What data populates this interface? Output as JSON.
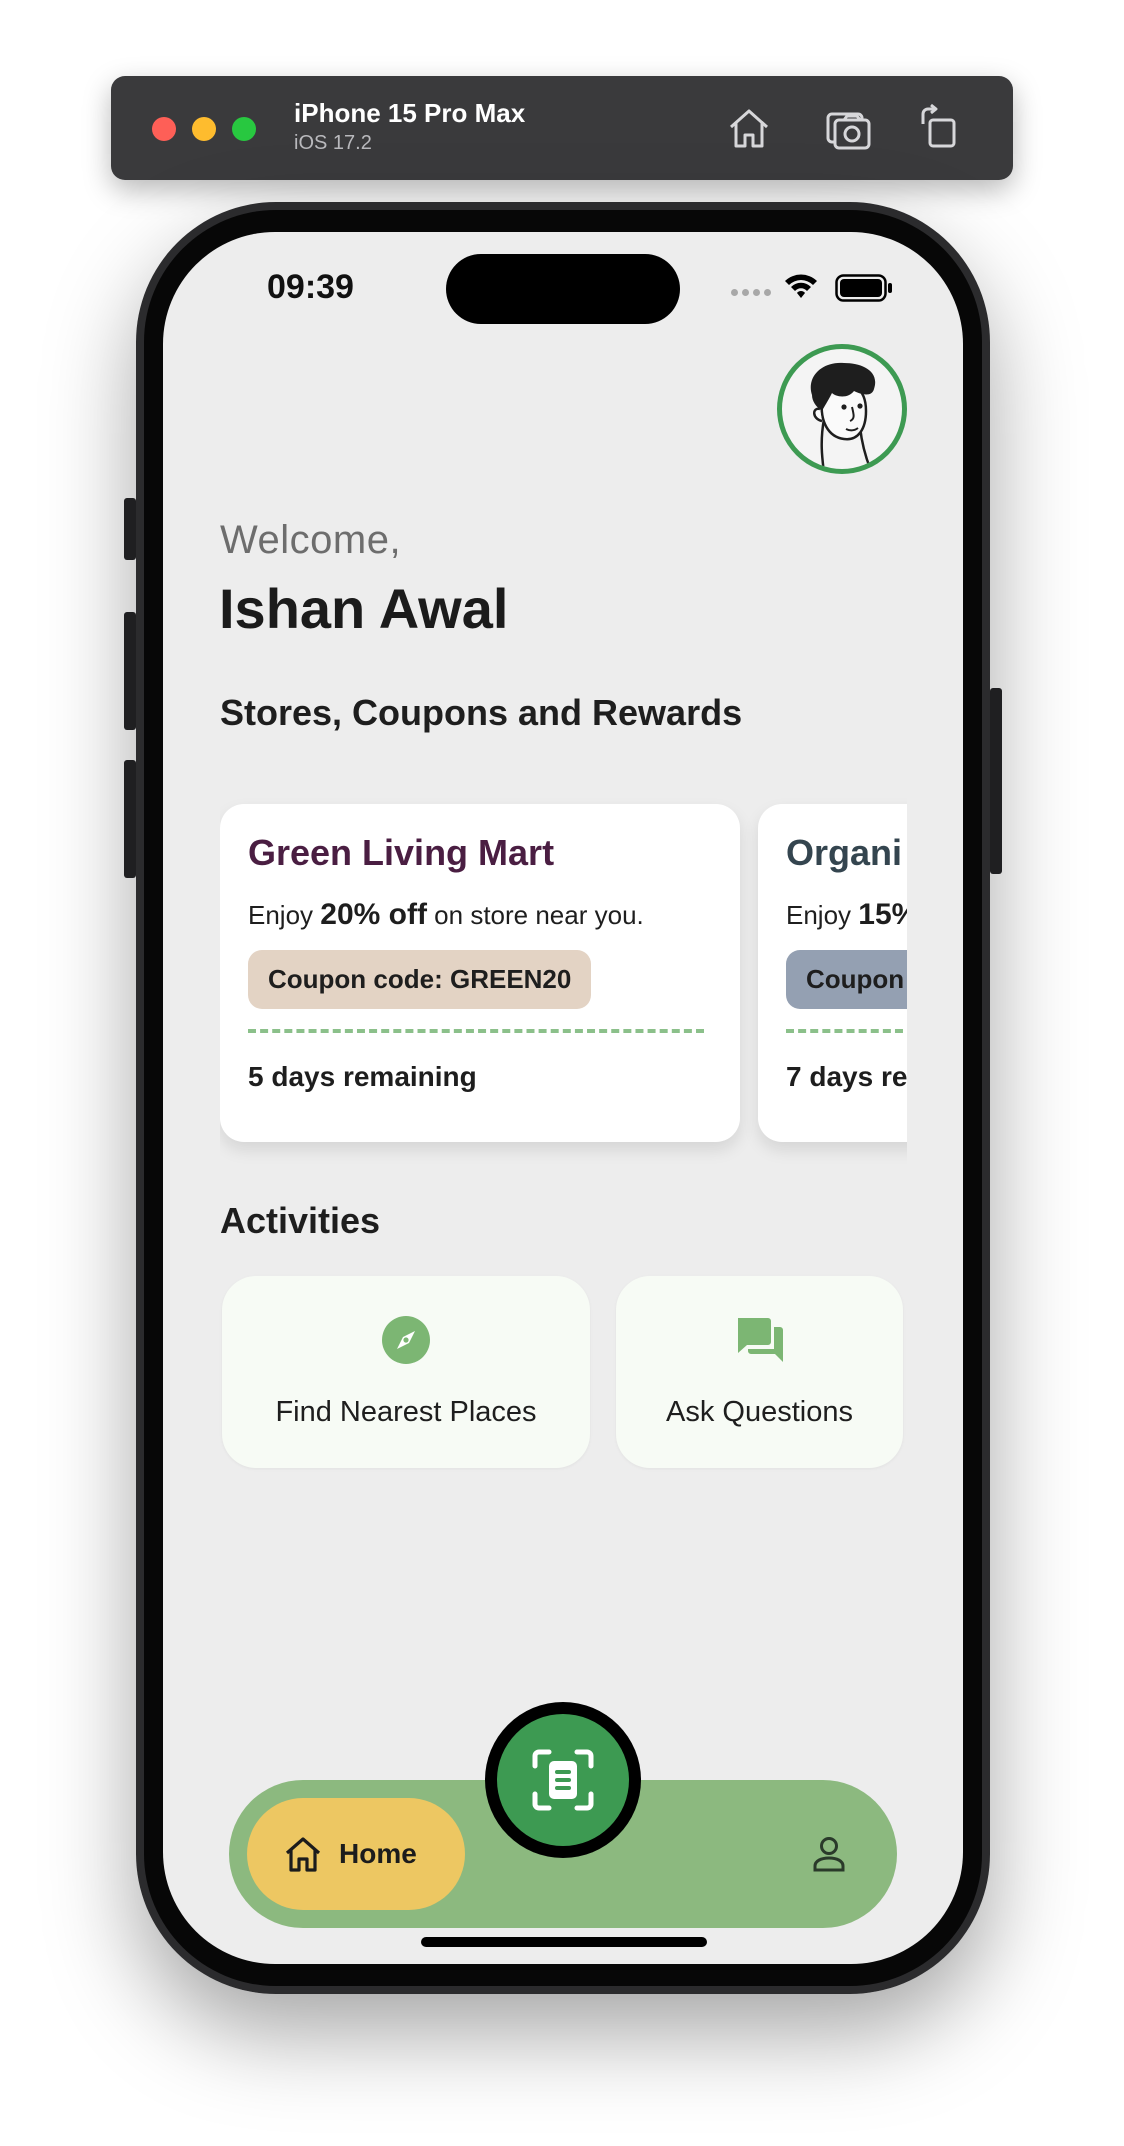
{
  "simulator": {
    "device_name": "iPhone 15 Pro Max",
    "os_version": "iOS 17.2",
    "toolbar_icons": [
      "home-icon",
      "screenshot-icon",
      "rotate-icon"
    ]
  },
  "status_bar": {
    "time": "09:39",
    "icons": [
      "signal-dots-icon",
      "wifi-icon",
      "battery-icon"
    ]
  },
  "header": {
    "greeting": "Welcome,",
    "user_name": "Ishan Awal",
    "avatar_icon": "avatar-illustration"
  },
  "sections": {
    "coupons_title": "Stores, Coupons and Rewards",
    "activities_title": "Activities"
  },
  "coupons": [
    {
      "store": "Green Living Mart",
      "offer_prefix": "Enjoy ",
      "discount": "20% off",
      "offer_suffix": " on store near you.",
      "code_label": "Coupon code: GREEN20",
      "remaining": "5 days remaining",
      "store_color": "#4a1e42",
      "pill_color": "#e3d3c4"
    },
    {
      "store": "Organi",
      "offer_prefix": "Enjoy ",
      "discount": "15%",
      "offer_suffix": "",
      "code_label": "Coupon",
      "remaining": "7 days re",
      "store_color": "#34454f",
      "pill_color": "#94a0b2"
    }
  ],
  "activities": [
    {
      "label": "Find Nearest Places",
      "icon": "compass-icon"
    },
    {
      "label": "Ask Questions",
      "icon": "chat-icon"
    }
  ],
  "bottom_nav": {
    "home_label": "Home",
    "home_icon": "home-icon",
    "scan_icon": "scan-document-icon",
    "profile_icon": "person-icon"
  },
  "colors": {
    "accent_green": "#3d9a52",
    "nav_green": "#8cb97f",
    "home_pill": "#edc762",
    "icon_green": "#7cb673",
    "screen_bg": "#ededed"
  }
}
